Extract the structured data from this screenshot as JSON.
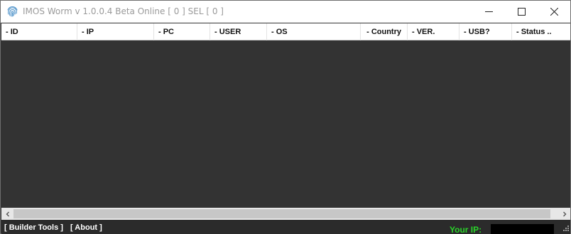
{
  "window": {
    "title": "IMOS Worm v 1.0.0.4 Beta Online [ 0 ] SEL [ 0 ]",
    "icon": "fingerprint-icon"
  },
  "columns": [
    {
      "label": "- ID"
    },
    {
      "label": "- IP"
    },
    {
      "label": "- PC"
    },
    {
      "label": "- USER"
    },
    {
      "label": "- OS"
    },
    {
      "label": "- Country"
    },
    {
      "label": "- VER."
    },
    {
      "label": "- USB?"
    },
    {
      "label": "- Status .."
    }
  ],
  "rows": [],
  "statusbar": {
    "builder_tools": "[ Builder Tools ]",
    "about": "[ About ]",
    "your_ip_label": "Your IP:",
    "your_ip_value": ""
  },
  "colors": {
    "list_background": "#333333",
    "ip_label": "#2ad42a",
    "status_text": "#ffffff"
  }
}
